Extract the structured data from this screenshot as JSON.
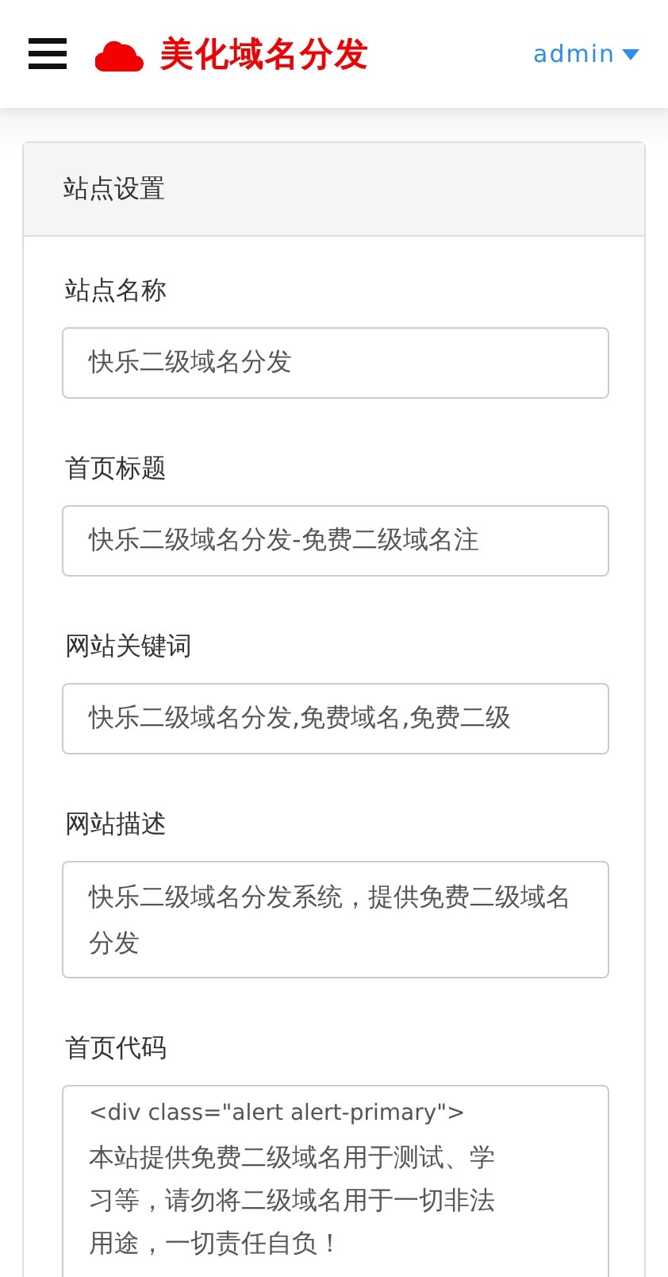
{
  "navbar": {
    "brand": "美化域名分发",
    "user": "admin"
  },
  "panel": {
    "title": "站点设置",
    "fields": [
      {
        "kind": "input",
        "label": "站点名称",
        "value": "快乐二级域名分发"
      },
      {
        "kind": "input",
        "label": "首页标题",
        "value": "快乐二级域名分发-免费二级域名注"
      },
      {
        "kind": "input",
        "label": "网站关键词",
        "value": "快乐二级域名分发,免费域名,免费二级"
      },
      {
        "kind": "textarea",
        "label": "网站描述",
        "value": "快乐二级域名分发系统，提供免费二级域名分发"
      },
      {
        "kind": "code",
        "label": "首页代码",
        "lines": [
          "<div class=\"alert alert-primary\">",
          "本站提供免费二级域名用于测试、学",
          "习等，请勿将二级域名用于一切非法",
          "用途，一切责任自负！"
        ]
      }
    ]
  }
}
